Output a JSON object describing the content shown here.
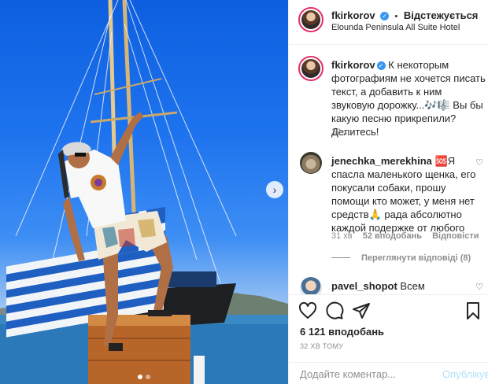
{
  "post": {
    "username": "fkirkorov",
    "follow_status": "Відстежується",
    "separator": "•",
    "location": "Elounda Peninsula All Suite Hotel"
  },
  "caption": {
    "username": "fkirkorov",
    "text": "К некоторым фотографиям не хочется писать текст, а добавить к ним звуковую дорожку...🎶🎼 Вы бы какую песню прикрепили? Делитесь!",
    "time": "32 хв"
  },
  "comments": [
    {
      "username": "jenechka_merekhina",
      "text": "🆘Я спасла маленького щенка, его покусали собаки, прошу помощи кто может, у меня нет средств🙏 рада абсолютно каждой подержке от любого",
      "time": "31 хв",
      "likes": "52 вподобань",
      "reply": "Відповісти",
      "view_replies": "Переглянути відповіді (8)"
    },
    {
      "username": "pavel_shopot",
      "text": "Всем"
    }
  ],
  "actions": {
    "likes_count": "6 121 вподобань",
    "time_ago": "32 ХВ ТОМУ",
    "comment_placeholder": "Додайте коментар...",
    "post_button": "Опублікувати"
  },
  "icons": [
    "heart-icon",
    "comment-icon",
    "share-icon",
    "bookmark-icon",
    "verified-badge-icon"
  ],
  "colors": {
    "accent": "#3897f0",
    "post_disabled": "#b2dffc",
    "muted": "#8e8e8e"
  }
}
